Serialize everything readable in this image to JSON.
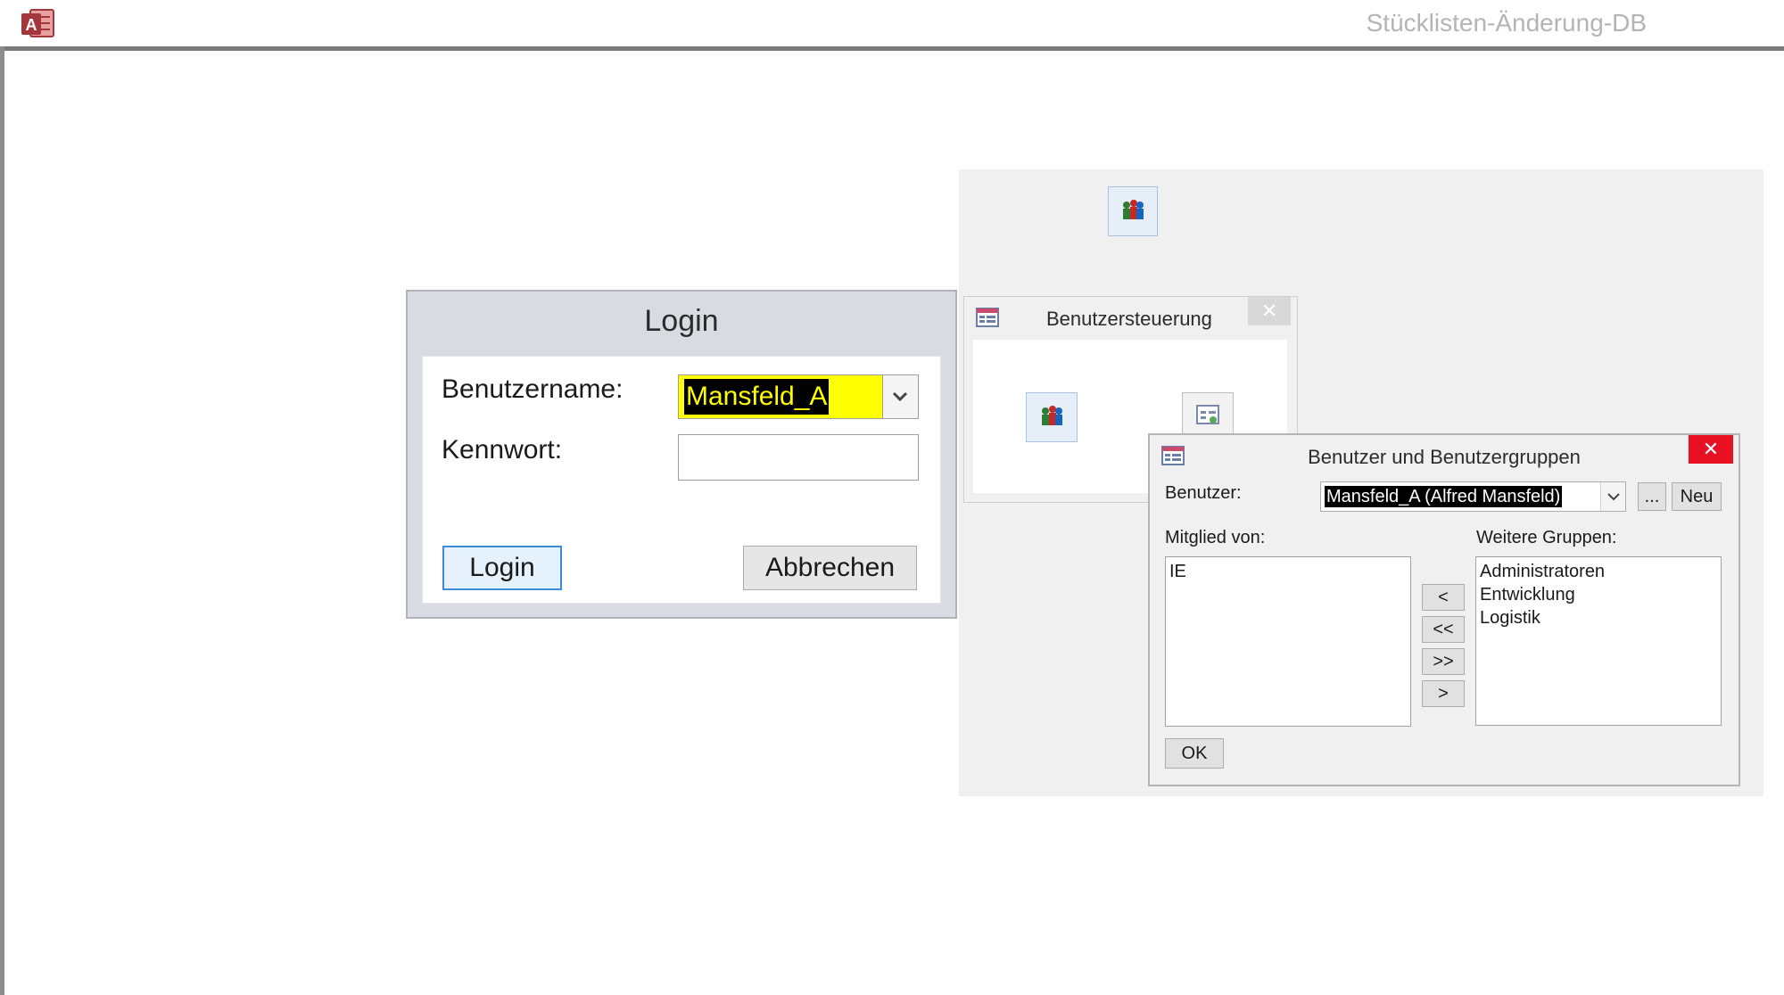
{
  "app": {
    "title": "Stücklisten-Änderung-DB",
    "logo_icon": "access-logo-icon",
    "accent": "#c0392b"
  },
  "login": {
    "title": "Login",
    "username_label": "Benutzername:",
    "username_value": "Mansfeld_A",
    "password_label": "Kennwort:",
    "password_value": "",
    "login_button": "Login",
    "cancel_button": "Abbrechen",
    "highlight_color": "#ffff00"
  },
  "user_control": {
    "title": "Benutzersteuerung",
    "close_label": "✕",
    "icons": [
      "users-icon",
      "users-icon",
      "form-icon"
    ]
  },
  "user_groups": {
    "title": "Benutzer und Benutzergruppen",
    "close_label": "✕",
    "user_label": "Benutzer:",
    "user_value": "Mansfeld_A (Alfred Mansfeld)",
    "browse_button": "...",
    "new_button": "Neu",
    "member_of_label": "Mitglied von:",
    "member_of": [
      "IE"
    ],
    "other_groups_label": "Weitere Gruppen:",
    "other_groups": [
      "Administratoren",
      "Entwicklung",
      "Logistik"
    ],
    "move_buttons": [
      "<",
      "<<",
      ">>",
      ">"
    ],
    "ok_button": "OK"
  }
}
